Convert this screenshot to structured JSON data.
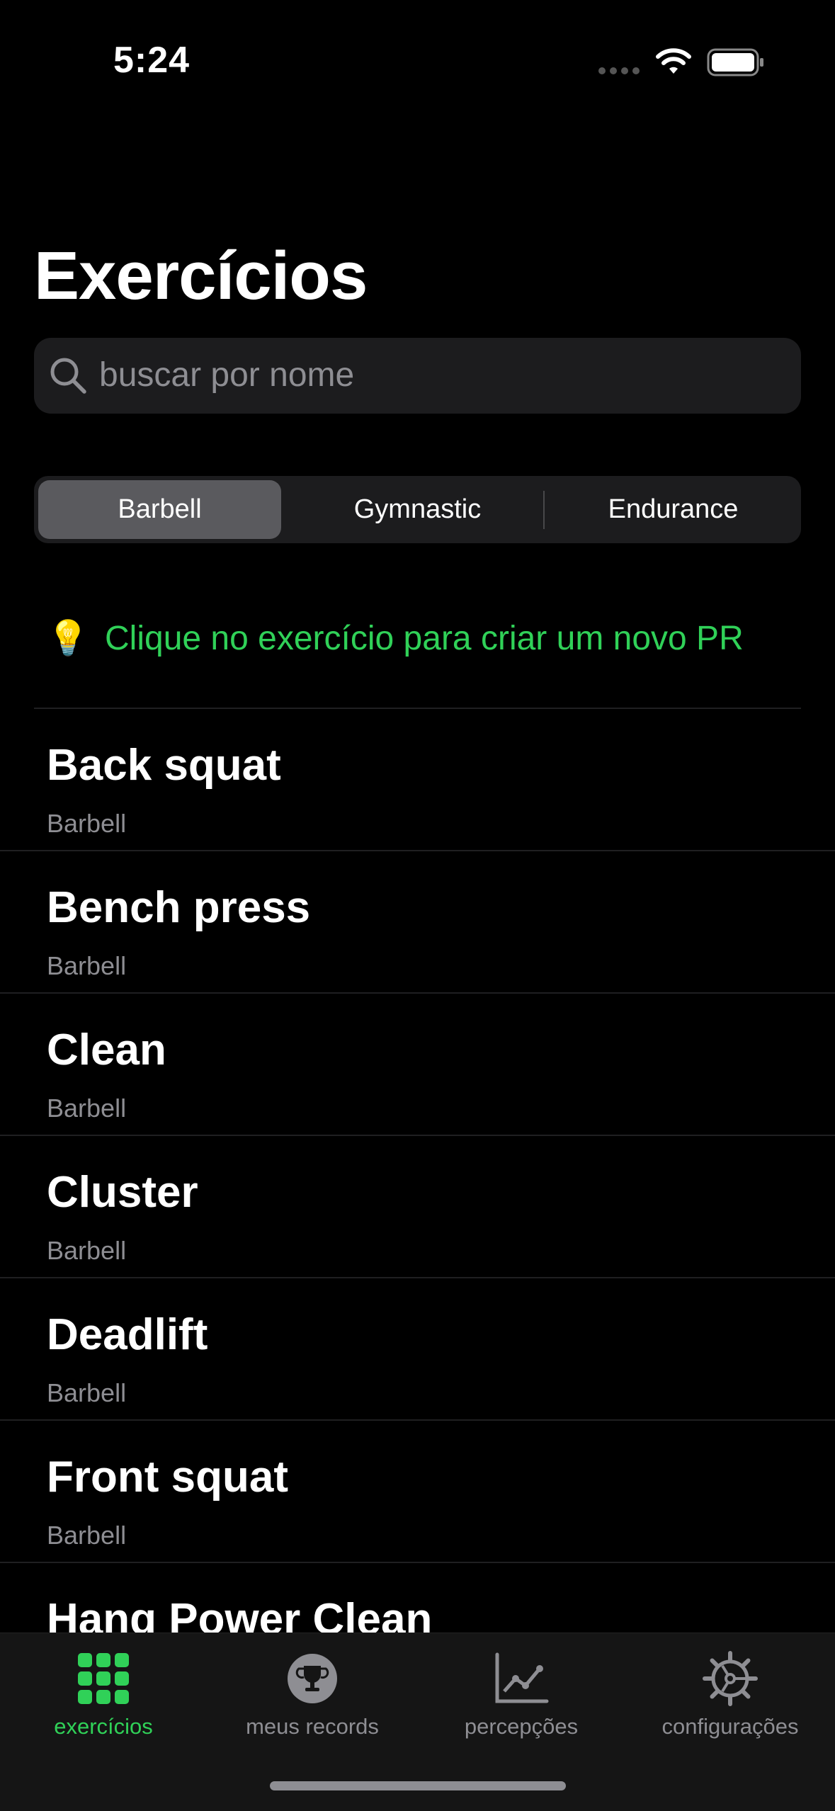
{
  "status_bar": {
    "time": "5:24"
  },
  "page": {
    "title": "Exercícios"
  },
  "search": {
    "placeholder": "buscar por nome"
  },
  "segments": [
    "Barbell",
    "Gymnastic",
    "Endurance"
  ],
  "selected_segment": "Barbell",
  "hint": {
    "icon": "💡",
    "text": "Clique no exercício para criar um novo PR"
  },
  "exercises": [
    {
      "name": "Back squat",
      "category": "Barbell"
    },
    {
      "name": "Bench press",
      "category": "Barbell"
    },
    {
      "name": "Clean",
      "category": "Barbell"
    },
    {
      "name": "Cluster",
      "category": "Barbell"
    },
    {
      "name": "Deadlift",
      "category": "Barbell"
    },
    {
      "name": "Front squat",
      "category": "Barbell"
    },
    {
      "name": "Hang Power Clean",
      "category": ""
    }
  ],
  "tabs": [
    {
      "label": "exercícios",
      "icon": "grid-icon",
      "active": true
    },
    {
      "label": "meus records",
      "icon": "trophy-icon",
      "active": false
    },
    {
      "label": "percepções",
      "icon": "line-chart-icon",
      "active": false
    },
    {
      "label": "configurações",
      "icon": "gear-icon",
      "active": false
    }
  ],
  "colors": {
    "accent": "#30d158",
    "background": "#000000",
    "secondary_text": "#8e8e93"
  }
}
